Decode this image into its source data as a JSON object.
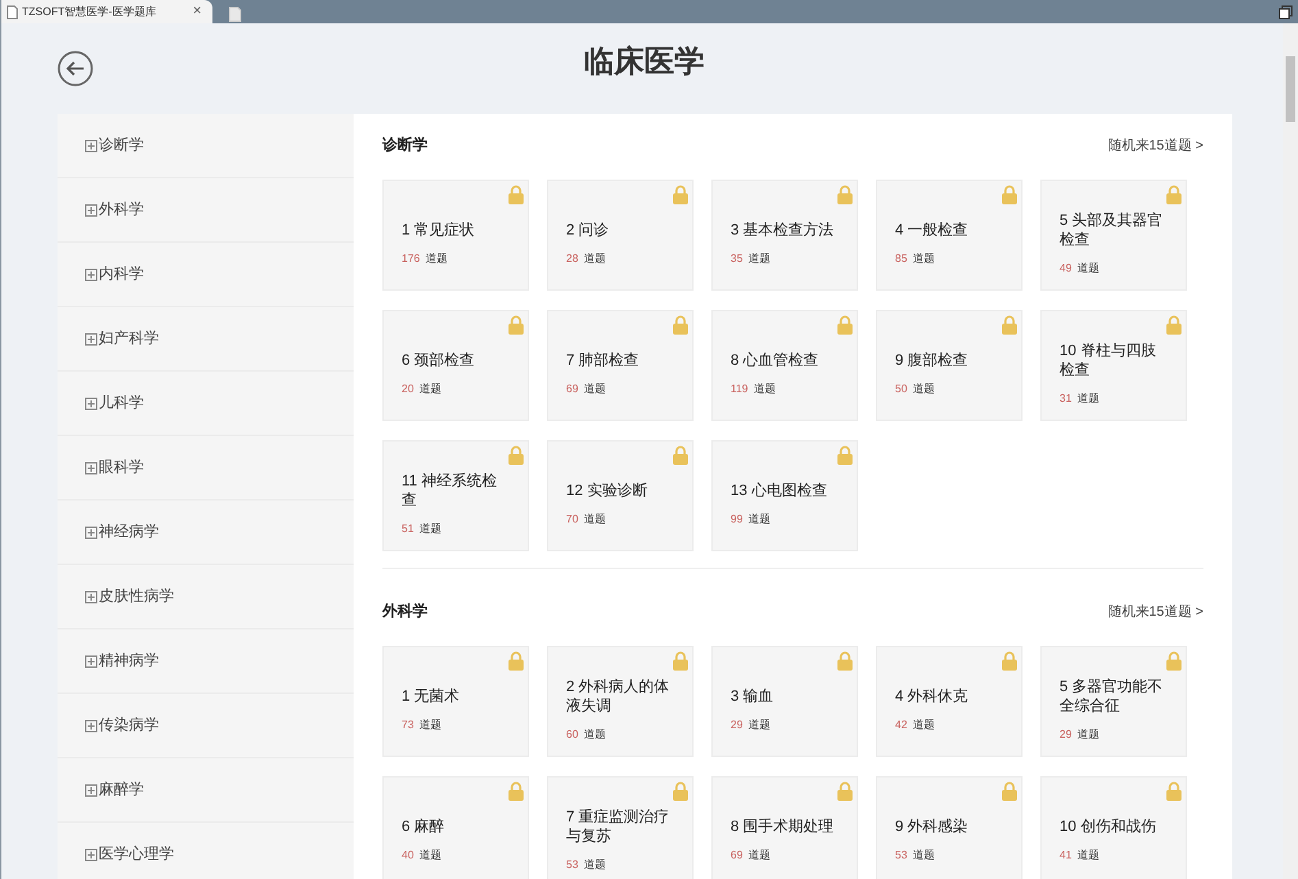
{
  "browser_tab": {
    "title": "TZSOFT智慧医学-医学题库",
    "close": "×"
  },
  "page": {
    "title": "临床医学"
  },
  "sidebar": {
    "items": [
      {
        "label": "诊断学"
      },
      {
        "label": "外科学"
      },
      {
        "label": "内科学"
      },
      {
        "label": "妇产科学"
      },
      {
        "label": "儿科学"
      },
      {
        "label": "眼科学"
      },
      {
        "label": "神经病学"
      },
      {
        "label": "皮肤性病学"
      },
      {
        "label": "精神病学"
      },
      {
        "label": "传染病学"
      },
      {
        "label": "麻醉学"
      },
      {
        "label": "医学心理学"
      }
    ]
  },
  "sections": [
    {
      "title": "诊断学",
      "random_link": "随机来15道题 >",
      "cards": [
        {
          "title": "1 常见症状",
          "count": "176",
          "unit": "道题",
          "locked": true
        },
        {
          "title": "2 问诊",
          "count": "28",
          "unit": "道题",
          "locked": true
        },
        {
          "title": "3 基本检查方法",
          "count": "35",
          "unit": "道题",
          "locked": true
        },
        {
          "title": "4 一般检查",
          "count": "85",
          "unit": "道题",
          "locked": true
        },
        {
          "title": "5 头部及其器官检查",
          "count": "49",
          "unit": "道题",
          "locked": true
        },
        {
          "title": "6 颈部检查",
          "count": "20",
          "unit": "道题",
          "locked": true
        },
        {
          "title": "7 肺部检查",
          "count": "69",
          "unit": "道题",
          "locked": true
        },
        {
          "title": "8 心血管检查",
          "count": "119",
          "unit": "道题",
          "locked": true
        },
        {
          "title": "9 腹部检查",
          "count": "50",
          "unit": "道题",
          "locked": true
        },
        {
          "title": "10 脊柱与四肢检查",
          "count": "31",
          "unit": "道题",
          "locked": true
        },
        {
          "title": "11 神经系统检查",
          "count": "51",
          "unit": "道题",
          "locked": true
        },
        {
          "title": "12 实验诊断",
          "count": "70",
          "unit": "道题",
          "locked": true
        },
        {
          "title": "13 心电图检查",
          "count": "99",
          "unit": "道题",
          "locked": true
        }
      ]
    },
    {
      "title": "外科学",
      "random_link": "随机来15道题 >",
      "cards": [
        {
          "title": "1 无菌术",
          "count": "73",
          "unit": "道题",
          "locked": true
        },
        {
          "title": "2 外科病人的体液失调",
          "count": "60",
          "unit": "道题",
          "locked": true
        },
        {
          "title": "3 输血",
          "count": "29",
          "unit": "道题",
          "locked": true
        },
        {
          "title": "4 外科休克",
          "count": "42",
          "unit": "道题",
          "locked": true
        },
        {
          "title": "5 多器官功能不全综合征",
          "count": "29",
          "unit": "道题",
          "locked": true
        },
        {
          "title": "6 麻醉",
          "count": "40",
          "unit": "道题",
          "locked": true
        },
        {
          "title": "7 重症监测治疗与复苏",
          "count": "53",
          "unit": "道题",
          "locked": true
        },
        {
          "title": "8 围手术期处理",
          "count": "69",
          "unit": "道题",
          "locked": true
        },
        {
          "title": "9 外科感染",
          "count": "53",
          "unit": "道题",
          "locked": true
        },
        {
          "title": "10 创伤和战伤",
          "count": "41",
          "unit": "道题",
          "locked": true
        }
      ]
    }
  ]
}
